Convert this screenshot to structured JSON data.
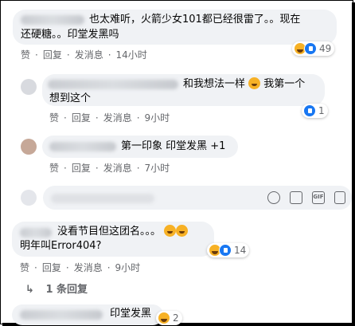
{
  "comments": [
    {
      "text_line1": "也太难听，火箭少女101都已经很雷了。。现在",
      "text_line2": "还硬糖。。印堂发黑吗",
      "actions": {
        "like": "赞",
        "reply": "回复",
        "message": "发消息",
        "time": "14小时"
      },
      "reactions": {
        "icons": [
          "haha",
          "like"
        ],
        "count": "49"
      }
    },
    {
      "text_line1": "和我想法一样",
      "text_after_emoji": "我第一个",
      "text_line2": "想到这个",
      "actions": {
        "like": "赞",
        "reply": "回复",
        "message": "发消息",
        "time": "9小时"
      },
      "reactions": {
        "icons": [
          "like"
        ],
        "count": "1"
      }
    },
    {
      "text_line1": "第一印象 印堂发黑 +1",
      "actions": {
        "like": "赞",
        "reply": "回复",
        "message": "发消息",
        "time": "7小时"
      }
    },
    {
      "text_line1": "没看节目但这团名。。。",
      "text_line2": "明年叫Error404?",
      "actions": {
        "like": "赞",
        "reply": "回复",
        "message": "发消息",
        "time": "9小时"
      },
      "reactions": {
        "icons": [
          "haha",
          "like"
        ],
        "count": "14"
      }
    },
    {
      "text_line1": "印堂发黑",
      "reactions": {
        "icons": [
          "haha"
        ],
        "count": "2"
      }
    }
  ],
  "reply_input": {
    "icons": [
      "emoji-icon",
      "camera-icon",
      "gif-icon",
      "sticker-icon"
    ],
    "gif_label": "GIF"
  },
  "more_replies": {
    "arrow": "↳",
    "label": "1 条回复"
  }
}
